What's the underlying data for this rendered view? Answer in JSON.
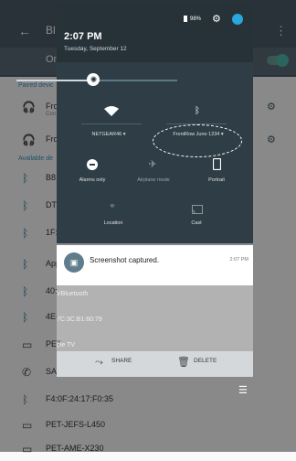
{
  "background": {
    "app_title": "Bl",
    "menu_icon": "overflow-menu-icon",
    "on_label": "On",
    "paired_header": "Paired devic",
    "available_header": "Available de",
    "paired_devices": [
      {
        "name": "Fro",
        "sub": "Con"
      },
      {
        "name": "Fro",
        "sub": ""
      }
    ],
    "available_devices": [
      {
        "name": "B8:",
        "icon": "bluetooth-icon"
      },
      {
        "name": "DTV",
        "icon": "bluetooth-icon"
      },
      {
        "name": "1F:",
        "icon": "bluetooth-icon"
      },
      {
        "name": "App",
        "icon": "bluetooth-icon"
      },
      {
        "name": "40:",
        "icon": "bluetooth-icon"
      },
      {
        "name": "4E-",
        "icon": "bluetooth-icon"
      },
      {
        "name": "PET",
        "icon": "laptop-icon"
      },
      {
        "name": "SAN",
        "icon": "phone-icon"
      },
      {
        "name": "F4:0F:24:17:F0:35",
        "icon": "bluetooth-icon"
      },
      {
        "name": "PET-JEFS-L450",
        "icon": "laptop-icon"
      },
      {
        "name": "PET-AME-X230",
        "icon": "laptop-icon"
      }
    ]
  },
  "shade": {
    "time": "2:07 PM",
    "date": "Tuesday, September 12",
    "battery": "98%",
    "brightness_fraction": 0.48,
    "tiles": [
      {
        "label": "NETGEAR46",
        "icon": "wifi-icon",
        "dropdown": true
      },
      {
        "label": "FrontRow Juno 1234",
        "icon": "bluetooth-icon",
        "dropdown": true
      },
      {
        "label": "Alarms only",
        "icon": "do-not-disturb-icon"
      },
      {
        "label": "Airplane mode",
        "icon": "airplane-icon"
      },
      {
        "label": "Portrait",
        "icon": "portrait-icon"
      },
      {
        "label": "Location",
        "icon": "location-off-icon"
      },
      {
        "label": "Cast",
        "icon": "cast-icon"
      }
    ]
  },
  "notification": {
    "title": "Screenshot captured.",
    "time": "2:07 PM",
    "preview_lines": [
      "VBluetooth",
      "7C:3C:B1:60:79",
      "ple TV"
    ],
    "actions": [
      {
        "label": "SHARE",
        "icon": "share-icon"
      },
      {
        "label": "DELETE",
        "icon": "trash-icon"
      }
    ]
  },
  "colors": {
    "shade_bg": "#263238",
    "accent": "#29a8e0",
    "appbar": "#4c5c66"
  }
}
